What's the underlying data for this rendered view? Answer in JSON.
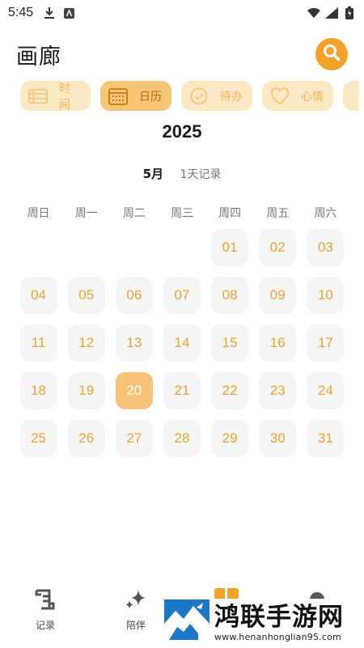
{
  "status_bar": {
    "time": "5:45"
  },
  "header": {
    "title": "画廊"
  },
  "tabs": [
    {
      "label": "时间",
      "icon": "timeline-icon"
    },
    {
      "label": "日历",
      "icon": "calendar-icon",
      "active": true
    },
    {
      "label": "待办",
      "icon": "check-circle-icon"
    },
    {
      "label": "心情",
      "icon": "heart-icon"
    }
  ],
  "calendar": {
    "year": "2025",
    "month": "5月",
    "record_count": "1天记录",
    "weekdays": [
      "周日",
      "周一",
      "周二",
      "周三",
      "周四",
      "周五",
      "周六"
    ],
    "leading_blanks": 4,
    "days": [
      "01",
      "02",
      "03",
      "04",
      "05",
      "06",
      "07",
      "08",
      "09",
      "10",
      "11",
      "12",
      "13",
      "14",
      "15",
      "16",
      "17",
      "18",
      "19",
      "20",
      "21",
      "22",
      "23",
      "24",
      "25",
      "26",
      "27",
      "28",
      "29",
      "30",
      "31"
    ],
    "selected_day": "20"
  },
  "bottom_nav": [
    {
      "label": "记录",
      "icon": "scroll-icon"
    },
    {
      "label": "陪伴",
      "icon": "sparkle-icon"
    }
  ],
  "watermark": {
    "title": "鸿联手游网",
    "url": "www.henanhonglian95.com"
  },
  "colors": {
    "accent": "#f0a22b",
    "tab_bg": "#fde8c4",
    "tab_active_bg": "#f7c578",
    "day_text": "#e9a13a",
    "day_selected_bg": "#f6c277"
  }
}
